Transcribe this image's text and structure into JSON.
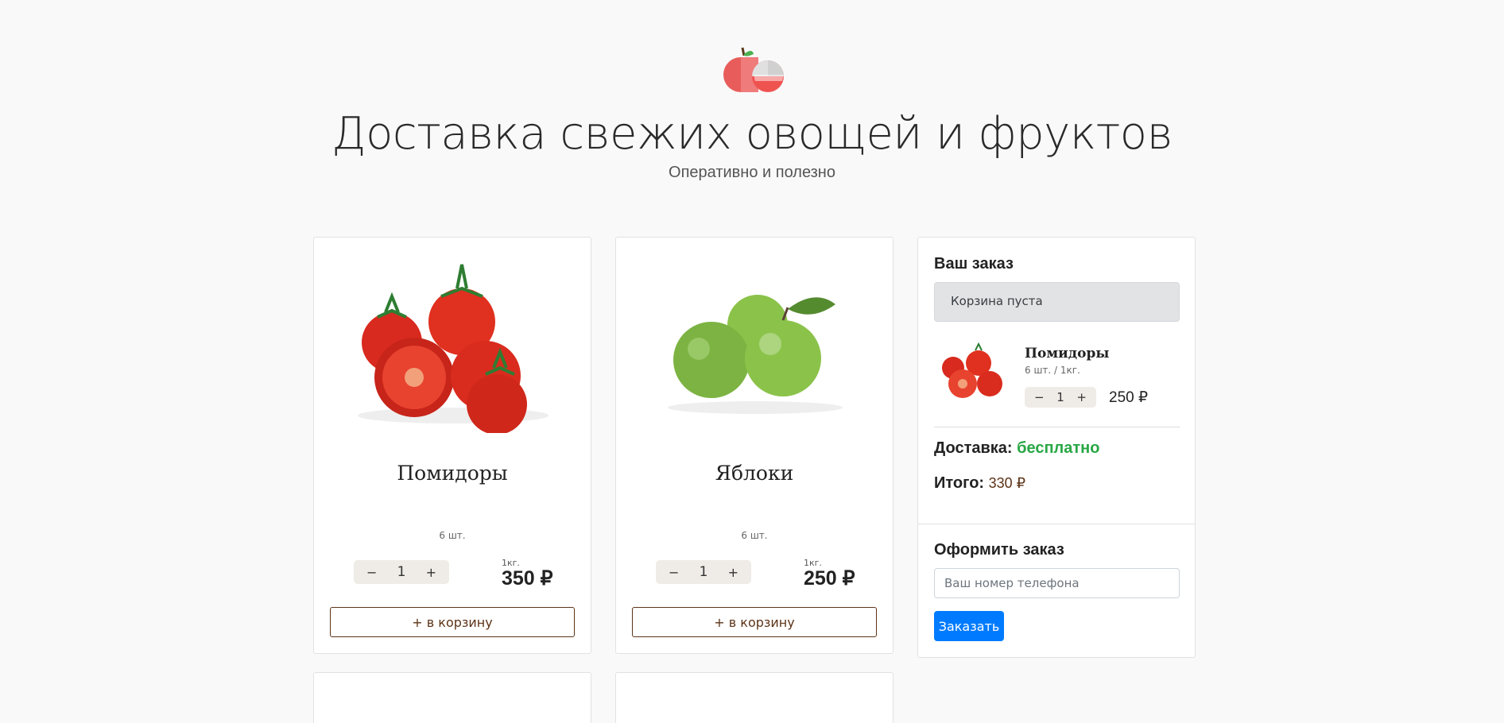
{
  "header": {
    "logo_icon": "fruit-basket-icon",
    "title": "Доставка свежих овощей и фруктов",
    "subtitle": "Оперативно и полезно"
  },
  "products": [
    {
      "name": "Помидоры",
      "count": "6 шт.",
      "qty_minus": "−",
      "qty": "1",
      "qty_plus": "+",
      "unit": "1кг.",
      "price": "350 ₽",
      "add_label": "+ в корзину",
      "image_icon": "tomatoes-image"
    },
    {
      "name": "Яблоки",
      "count": "6 шт.",
      "qty_minus": "−",
      "qty": "1",
      "qty_plus": "+",
      "unit": "1кг.",
      "price": "250 ₽",
      "add_label": "+ в корзину",
      "image_icon": "apples-image"
    }
  ],
  "order": {
    "title": "Ваш заказ",
    "empty_text": "Корзина пуста",
    "item": {
      "name": "Помидоры",
      "meta": "6 шт. / 1кг.",
      "qty_minus": "−",
      "qty": "1",
      "qty_plus": "+",
      "price": "250 ₽"
    },
    "delivery_label": "Доставка:",
    "delivery_value": "бесплатно",
    "total_label": "Итого:",
    "total_value": "330 ₽",
    "checkout_title": "Оформить заказ",
    "phone_placeholder": "Ваш номер телефона",
    "submit_label": "Заказать"
  },
  "colors": {
    "accent": "#007bff",
    "brown": "#5c3317",
    "green": "#28a745",
    "stepper_bg": "#efebe6"
  }
}
